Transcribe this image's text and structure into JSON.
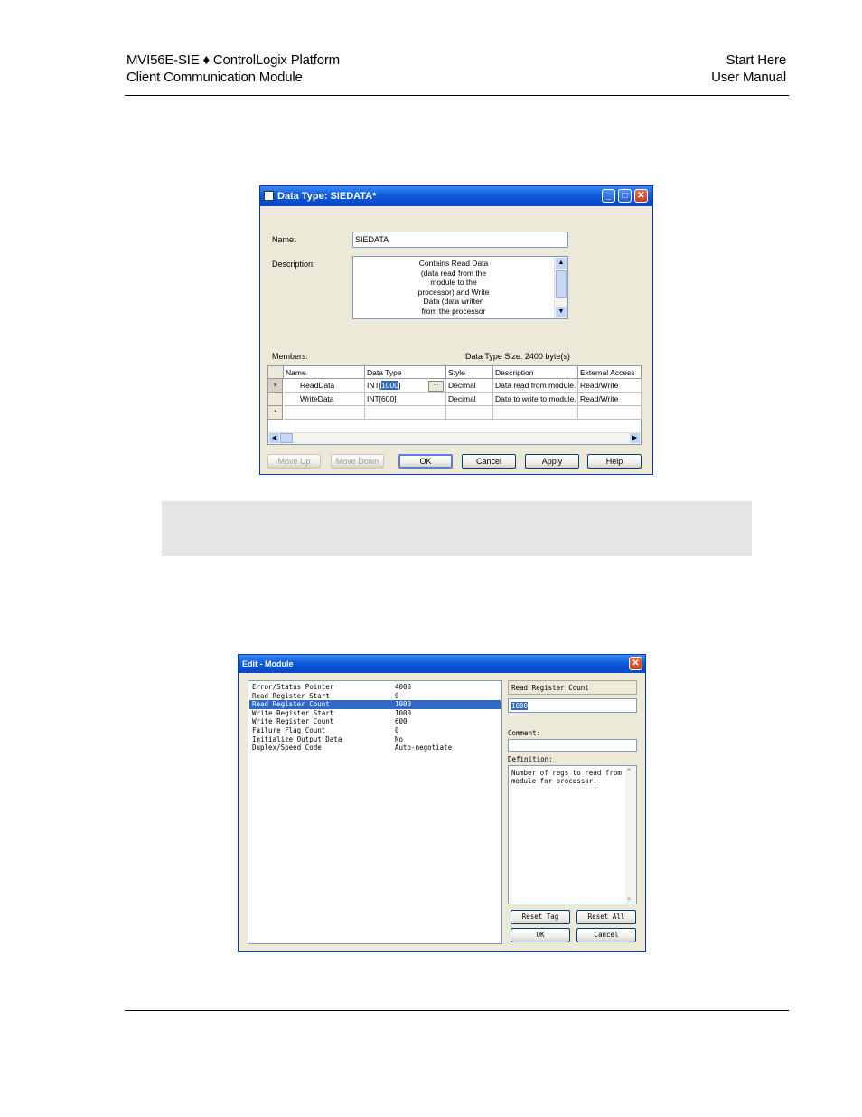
{
  "header": {
    "left_line1": "MVI56E-SIE ♦ ControlLogix Platform",
    "left_line2": "Client Communication Module",
    "right_line1": "Start Here",
    "right_line2": "User Manual"
  },
  "datatype_dialog": {
    "title": "Data Type:  SIEDATA*",
    "name_label": "Name:",
    "name_value": "SIEDATA",
    "description_label": "Description:",
    "description_lines": [
      "Contains Read Data",
      "(data read from the",
      "module to the",
      "processor) and Write",
      "Data (data written",
      "from the processor"
    ],
    "members_label": "Members:",
    "size_label": "Data Type Size: 2400 byte(s)",
    "columns": [
      "Name",
      "Data Type",
      "Style",
      "Description",
      "External Access"
    ],
    "rows": [
      {
        "marker": "×",
        "name": "ReadData",
        "type_prefix": "INT[",
        "type_sel": "1000",
        "type_suffix": "]",
        "style": "Decimal",
        "desc": "Data read from module.",
        "access": "Read/Write"
      },
      {
        "marker": "",
        "name": "WriteData",
        "type_prefix": "INT[600]",
        "type_sel": "",
        "type_suffix": "",
        "style": "Decimal",
        "desc": "Data to write to module.",
        "access": "Read/Write"
      }
    ],
    "new_row_marker": "*",
    "ellipsis": "...",
    "buttons": {
      "move_up": "Move Up",
      "move_down": "Move Down",
      "ok": "OK",
      "cancel": "Cancel",
      "apply": "Apply",
      "help": "Help"
    }
  },
  "edit_module": {
    "title": "Edit - Module",
    "params": [
      {
        "name": "Error/Status Pointer",
        "value": "4000",
        "selected": false
      },
      {
        "name": "Read Register Start",
        "value": "0",
        "selected": false
      },
      {
        "name": "Read Register Count",
        "value": "1000",
        "selected": true
      },
      {
        "name": "Write Register Start",
        "value": "1000",
        "selected": false
      },
      {
        "name": "Write Register Count",
        "value": "600",
        "selected": false
      },
      {
        "name": "Failure Flag Count",
        "value": "0",
        "selected": false
      },
      {
        "name": "Initialize Output Data",
        "value": "No",
        "selected": false
      },
      {
        "name": "Duplex/Speed Code",
        "value": "Auto-negotiate",
        "selected": false
      }
    ],
    "selected_param": "Read Register Count",
    "value": "1000",
    "comment_label": "Comment:",
    "definition_label": "Definition:",
    "definition_text": "Number of regs to read from module for processor.",
    "buttons": {
      "reset_tag": "Reset Tag",
      "reset_all": "Reset All",
      "ok": "OK",
      "cancel": "Cancel"
    }
  }
}
